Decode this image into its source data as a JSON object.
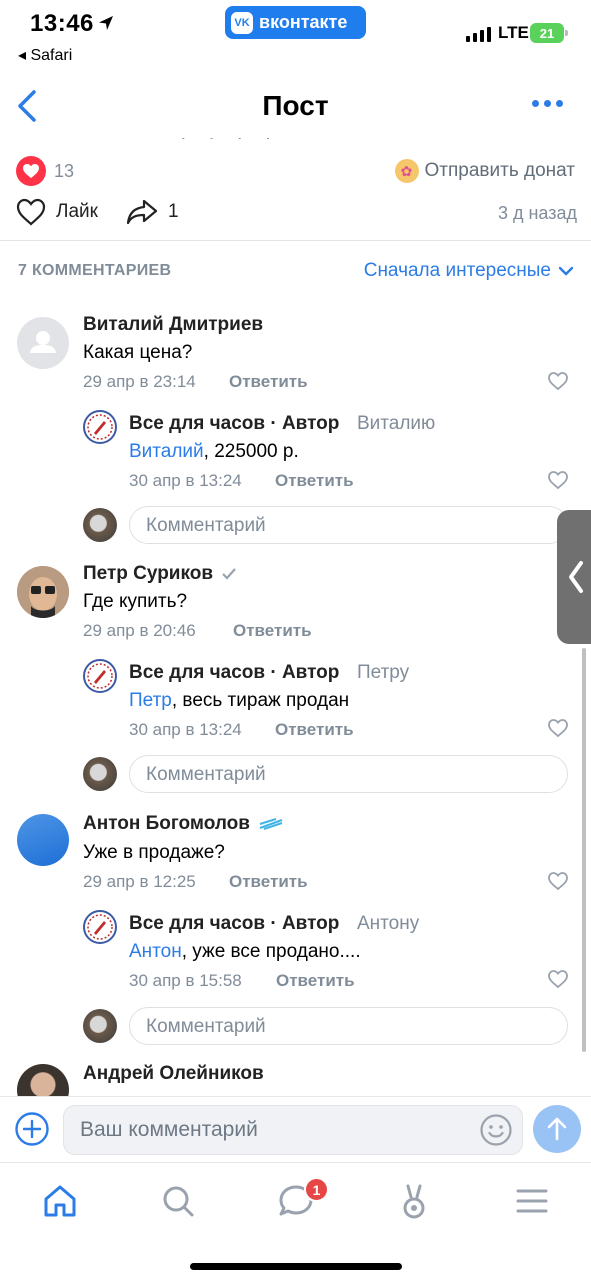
{
  "status_bar": {
    "time": "13:46",
    "back_app": "◂ Safari",
    "app_badge": "вконтакте",
    "network": "LTE",
    "battery": "21"
  },
  "nav": {
    "title": "Пост"
  },
  "post": {
    "reactions_count": "13",
    "donate_label": "Отправить донат",
    "like_label": "Лайк",
    "shares_count": "1",
    "posted_ago": "3 д назад"
  },
  "comments_header": {
    "count_label": "7 КОММЕНТАРИЕВ",
    "sort_label": "Сначала интересные"
  },
  "comments": [
    {
      "author": "Виталий Дмитриев",
      "text": "Какая цена?",
      "date": "29 апр в 23:14",
      "reply_label": "Ответить",
      "reply": {
        "author": "Все для часов · Автор",
        "to": "Виталию",
        "mention": "Виталий",
        "text": ", 225000 р.",
        "date": "30 апр в 13:24",
        "reply_label": "Ответить"
      },
      "input_placeholder": "Комментарий"
    },
    {
      "author": "Петр Суриков",
      "text": "Где купить?",
      "date": "29 апр в 20:46",
      "reply_label": "Ответить",
      "reply": {
        "author": "Все для часов · Автор",
        "to": "Петру",
        "mention": "Петр",
        "text": ", весь тираж продан",
        "date": "30 апр в 13:24",
        "reply_label": "Ответить"
      },
      "input_placeholder": "Комментарий"
    },
    {
      "author": "Антон Богомолов",
      "text": "Уже в продаже?",
      "date": "29 апр в 12:25",
      "reply_label": "Ответить",
      "reply": {
        "author": "Все для часов · Автор",
        "to": "Антону",
        "mention": "Антон",
        "text": ", уже все продано....",
        "date": "30 апр в 15:58",
        "reply_label": "Ответить"
      },
      "input_placeholder": "Комментарий"
    },
    {
      "author": "Андрей Олейников"
    }
  ],
  "compose": {
    "placeholder": "Ваш комментарий"
  },
  "tabbar": {
    "messages_badge": "1"
  },
  "colors": {
    "accent": "#2b7ce6",
    "like_red": "#ff3347",
    "secondary_text": "#818c99"
  }
}
